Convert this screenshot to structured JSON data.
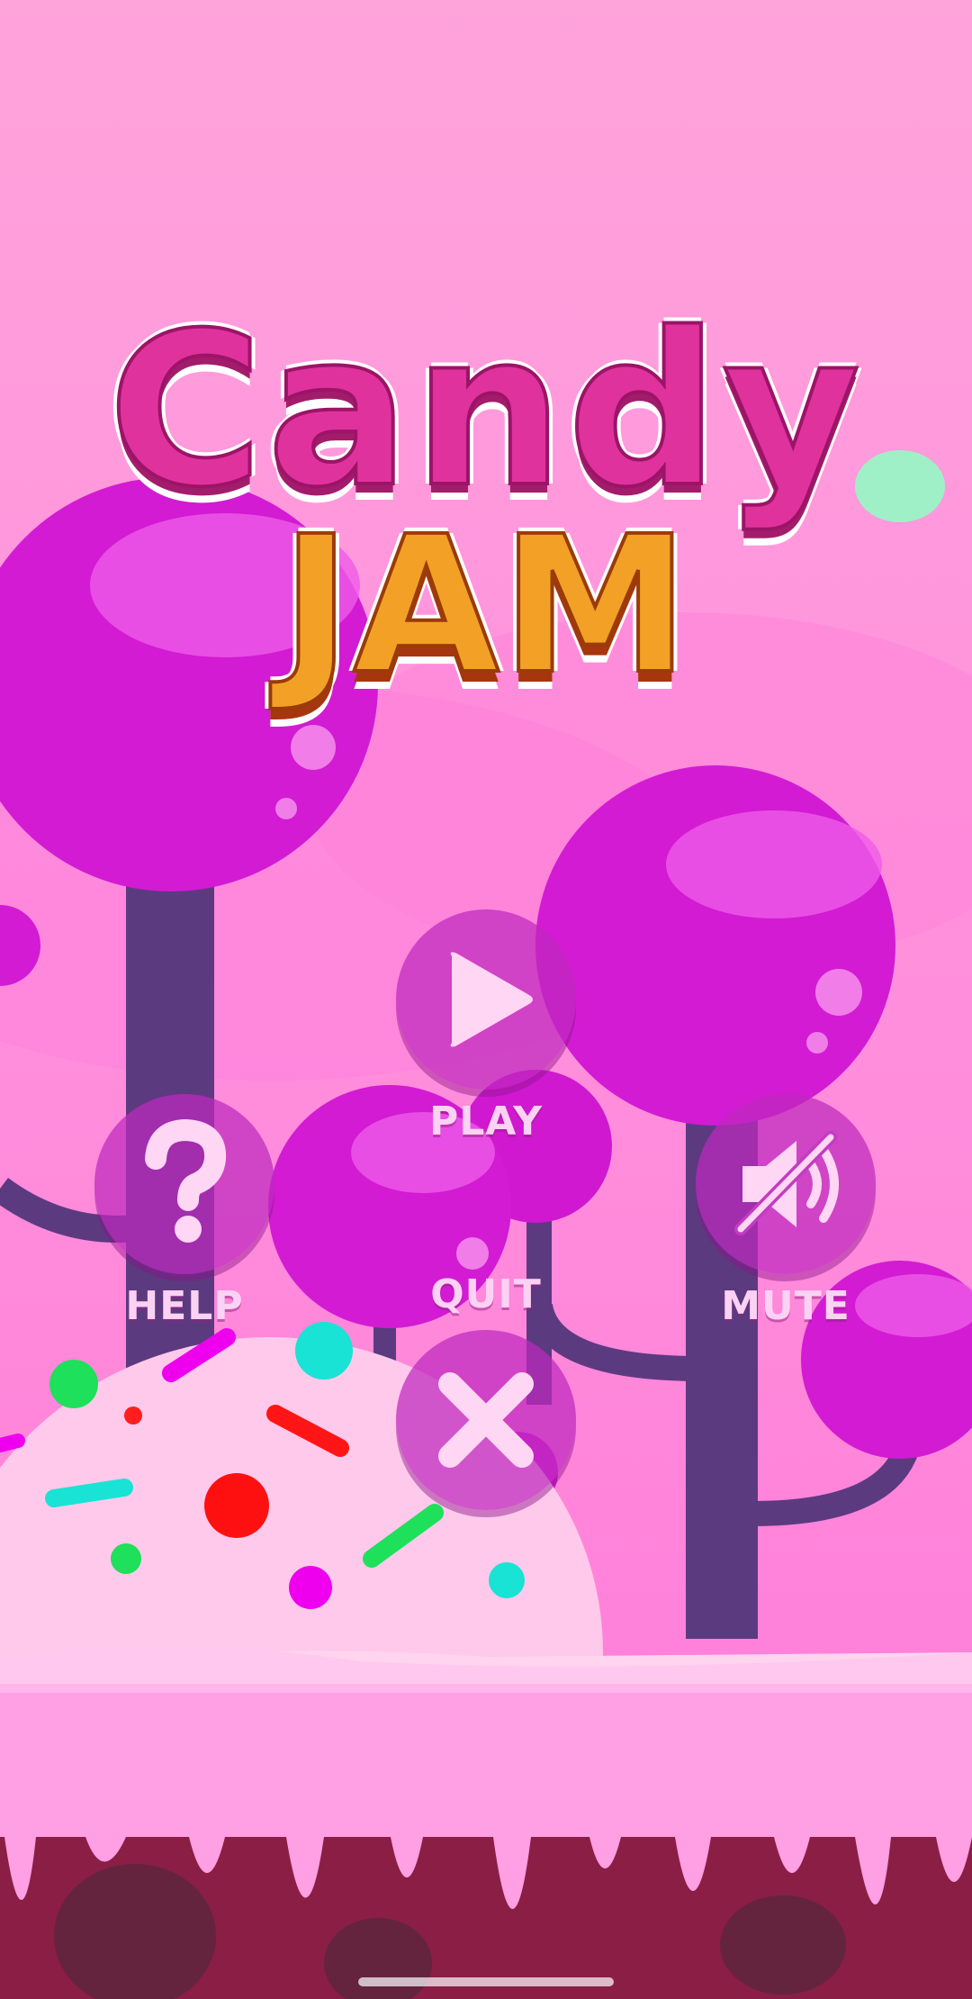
{
  "logo": {
    "line1": "Candy",
    "line2": "JAM"
  },
  "menu": {
    "play": {
      "label": "PLAY",
      "icon": "play-icon"
    },
    "help": {
      "label": "HELP",
      "icon": "question-mark-icon"
    },
    "mute": {
      "label": "MUTE",
      "icon": "speaker-muted-icon"
    },
    "quit": {
      "label": "QUIT",
      "icon": "close-icon"
    }
  },
  "colors": {
    "sky": "#ff9ed8",
    "button": "#be28be",
    "label": "#fbd2f3",
    "icing": "#ffa5e6",
    "ground": "#8a1e45"
  }
}
